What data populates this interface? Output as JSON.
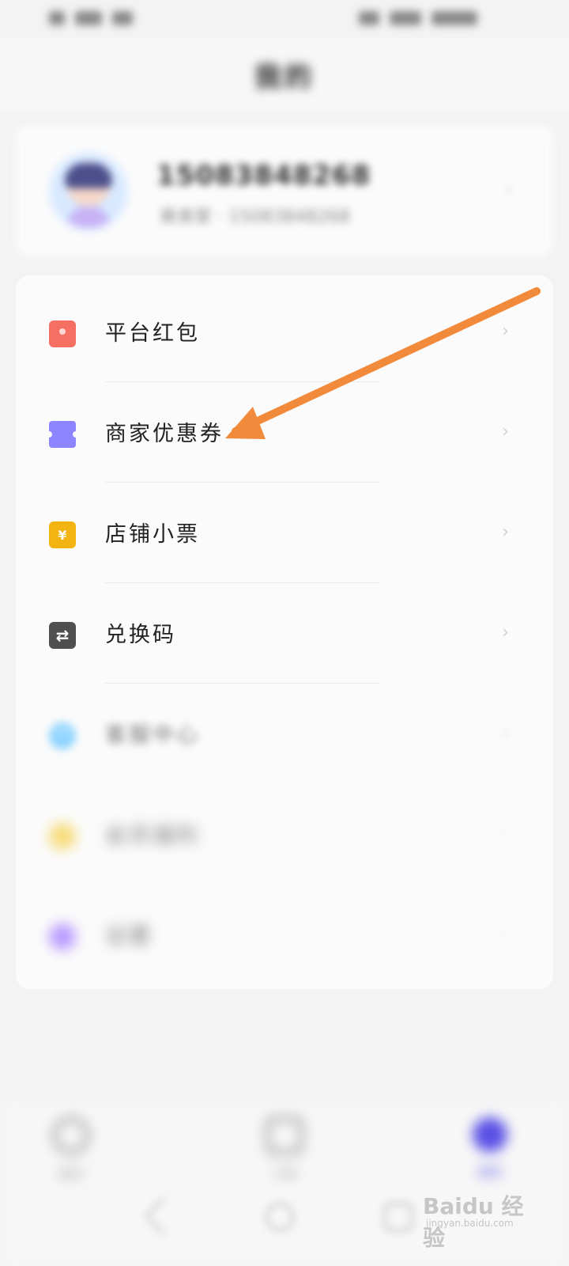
{
  "status_bar": {
    "left": "▮ᵢl 4G ᵣ",
    "right": "◫ 78 ◫ 65 17:17"
  },
  "header": {
    "title": "我的"
  },
  "profile": {
    "name": "15083848268",
    "subtitle": "美食家 · 15083848268",
    "arrow": "›"
  },
  "menu": {
    "items": [
      {
        "label": "平台红包",
        "icon": "red-envelope-icon"
      },
      {
        "label": "商家优惠券",
        "icon": "coupon-icon"
      },
      {
        "label": "店铺小票",
        "icon": "receipt-icon"
      },
      {
        "label": "兑换码",
        "icon": "exchange-code-icon"
      },
      {
        "label": "客服中心",
        "icon": "chat-bubble-icon"
      },
      {
        "label": "会员福利",
        "icon": "gift-icon"
      },
      {
        "label": "设置",
        "icon": "settings-icon"
      }
    ],
    "chevron": "›"
  },
  "bottom_nav": {
    "items": [
      {
        "label": "首页",
        "icon": "home-icon"
      },
      {
        "label": "订单",
        "icon": "orders-icon"
      },
      {
        "label": "我的",
        "icon": "profile-icon"
      }
    ]
  },
  "watermark": {
    "main": "Baidu 经验",
    "sub": "jingyan.baidu.com"
  },
  "colors": {
    "arrow": "#f28a3c",
    "active_nav": "#5a50e6",
    "background": "#f3f3f3",
    "card": "#fbfbfb"
  }
}
